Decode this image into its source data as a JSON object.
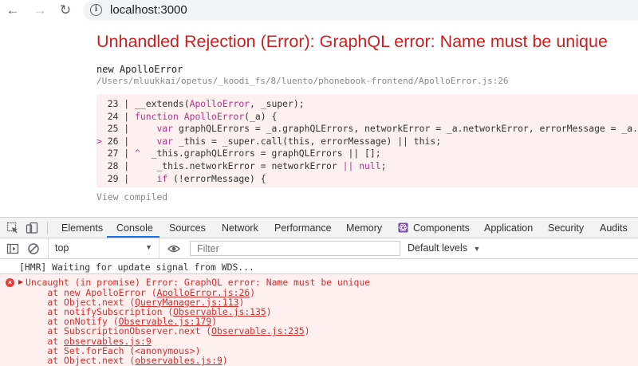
{
  "browser": {
    "url": "localhost:3000"
  },
  "overlay": {
    "title": "Unhandled Rejection (Error): GraphQL error: Name must be unique",
    "error_name": "new ApolloError",
    "error_path": "/Users/mluukkai/opetus/_koodi_fs/8/luento/phonebook-frontend/ApolloError.js:26",
    "code_lines": [
      {
        "marker": " ",
        "num": "23",
        "sep": " | ",
        "pre": "__extends(",
        "kw": "ApolloError",
        "post": ", _super);"
      },
      {
        "marker": " ",
        "num": "24",
        "sep": " | ",
        "pre": "",
        "kw": "function ApolloError",
        "post": "(_a) {"
      },
      {
        "marker": " ",
        "num": "25",
        "sep": " | ",
        "pre": "    ",
        "kw": "var",
        "post": " graphQLErrors = _a.graphQLErrors, networkError = _a.networkError, errorMessage = _a.errorMe"
      },
      {
        "marker": ">",
        "num": "26",
        "sep": " | ",
        "pre": "    ",
        "kw": "var",
        "post": " _this = _super.call(this, errorMessage) || this;"
      },
      {
        "marker": " ",
        "num": "27",
        "sep": " | ",
        "caret": "^",
        "pre": "  _this.graphQLErrors = graphQLErrors || [];",
        "kw": "",
        "post": ""
      },
      {
        "marker": " ",
        "num": "28",
        "sep": " | ",
        "pre": "    _this.networkError = networkError ",
        "kw": "|| null",
        "post": ";"
      },
      {
        "marker": " ",
        "num": "29",
        "sep": " | ",
        "pre": "    ",
        "kw": "if",
        "post": " (!errorMessage) {"
      }
    ],
    "view_compiled": "View compiled"
  },
  "devtools": {
    "tabs": [
      "Elements",
      "Console",
      "Sources",
      "Network",
      "Performance",
      "Memory",
      "Components",
      "Application",
      "Security",
      "Audits"
    ],
    "active_tab": "Console",
    "context": "top",
    "filter_placeholder": "Filter",
    "levels": "Default levels",
    "info_message": "[HMR] Waiting for update signal from WDS...",
    "error_message": "Uncaught (in promise) Error: GraphQL error: Name must be unique",
    "stack": [
      {
        "prefix": "    at new ApolloError (",
        "link": "ApolloError.js:26",
        "suffix": ")"
      },
      {
        "prefix": "    at Object.next (",
        "link": "QueryManager.js:113",
        "suffix": ")"
      },
      {
        "prefix": "    at notifySubscription (",
        "link": "Observable.js:135",
        "suffix": ")"
      },
      {
        "prefix": "    at onNotify (",
        "link": "Observable.js:179",
        "suffix": ")"
      },
      {
        "prefix": "    at SubscriptionObserver.next (",
        "link": "Observable.js:235",
        "suffix": ")"
      },
      {
        "prefix": "    at ",
        "link": "observables.js:9",
        "suffix": ""
      },
      {
        "prefix": "    at Set.forEach (<anonymous>)",
        "link": "",
        "suffix": ""
      },
      {
        "prefix": "    at Object.next (",
        "link": "observables.js:9",
        "suffix": ")"
      }
    ]
  },
  "colors": {
    "error_red": "#cc1f1f",
    "code_bg": "#fdf0f0",
    "keyword": "#b5338a",
    "active_tab_underline": "#1a73e8"
  }
}
